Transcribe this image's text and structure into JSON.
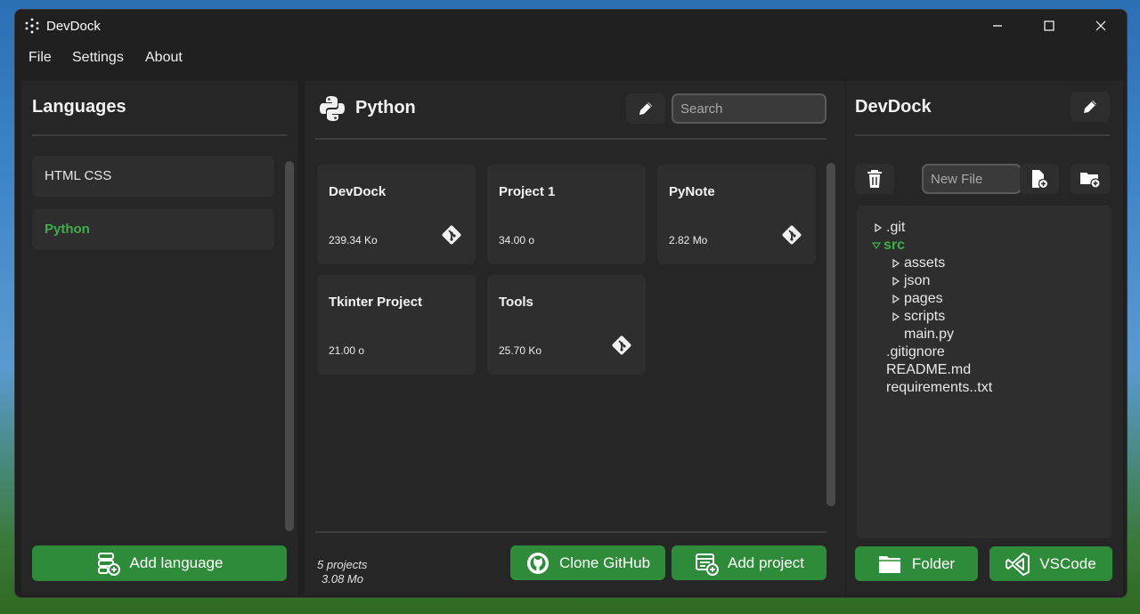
{
  "window": {
    "title": "DevDock"
  },
  "menu": [
    "File",
    "Settings",
    "About"
  ],
  "languages_panel": {
    "title": "Languages",
    "items": [
      {
        "label": "HTML CSS",
        "selected": false
      },
      {
        "label": "Python",
        "selected": true
      }
    ],
    "add_button": "Add language"
  },
  "projects_panel": {
    "language": "Python",
    "search_placeholder": "Search",
    "projects": [
      {
        "name": "DevDock",
        "size": "239.34 Ko",
        "git": true
      },
      {
        "name": "Project 1",
        "size": "34.00 o",
        "git": false
      },
      {
        "name": "PyNote",
        "size": "2.82 Mo",
        "git": true
      },
      {
        "name": "Tkinter Project",
        "size": "21.00 o",
        "git": false
      },
      {
        "name": "Tools",
        "size": "25.70 Ko",
        "git": true
      }
    ],
    "stats": {
      "count": "5 projects",
      "total_size": "3.08 Mo"
    },
    "clone_button": "Clone GitHub",
    "add_button": "Add project"
  },
  "files_panel": {
    "title": "DevDock",
    "new_file_placeholder": "New File",
    "tree": [
      {
        "label": ".git",
        "type": "folder",
        "open": false,
        "depth": 0
      },
      {
        "label": "src",
        "type": "folder",
        "open": true,
        "depth": 0
      },
      {
        "label": "assets",
        "type": "folder",
        "open": false,
        "depth": 1
      },
      {
        "label": "json",
        "type": "folder",
        "open": false,
        "depth": 1
      },
      {
        "label": "pages",
        "type": "folder",
        "open": false,
        "depth": 1
      },
      {
        "label": "scripts",
        "type": "folder",
        "open": false,
        "depth": 1
      },
      {
        "label": "main.py",
        "type": "file",
        "depth": 1
      },
      {
        "label": ".gitignore",
        "type": "file",
        "depth": 0
      },
      {
        "label": "README.md",
        "type": "file",
        "depth": 0
      },
      {
        "label": "requirements..txt",
        "type": "file",
        "depth": 0
      }
    ],
    "folder_button": "Folder",
    "vscode_button": "VSCode"
  },
  "colors": {
    "accent_green": "#2e8b3a",
    "selected_text": "#3fae4a",
    "panel_bg": "#262626",
    "window_bg": "#202020"
  }
}
